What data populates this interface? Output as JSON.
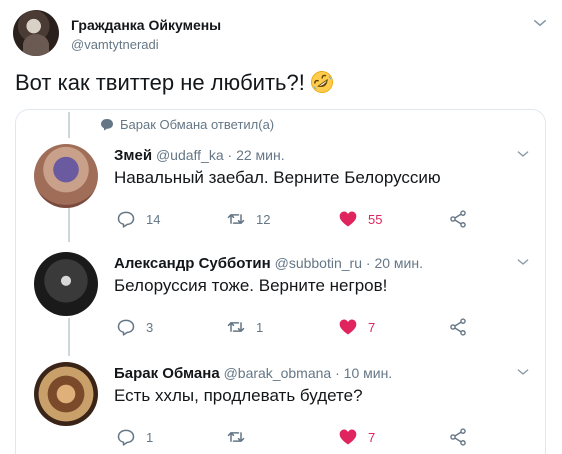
{
  "outer_tweet": {
    "author_name": "Гражданка Ойкумены",
    "author_handle": "@vamtytneradi",
    "text": "Вот как твиттер не любить?!",
    "emoji": "rolling-on-floor-laughing-icon"
  },
  "quoted": {
    "reply_context": "Барак Обмана ответил(а)",
    "tweets": [
      {
        "name": "Змей",
        "handle": "@udaff_ka",
        "time": "22 мин.",
        "text": "Навальный заебал. Верните Белоруссию",
        "replies": "14",
        "retweets": "12",
        "likes": "55"
      },
      {
        "name": "Александр Субботин",
        "handle": "@subbotin_ru",
        "time": "20 мин.",
        "text": "Белоруссия тоже. Верните негров!",
        "replies": "3",
        "retweets": "1",
        "likes": "7"
      },
      {
        "name": "Барак Обмана",
        "handle": "@barak_obmana",
        "time": "10 мин.",
        "text": "Есть ххлы, продлевать будете?",
        "replies": "1",
        "retweets": "",
        "likes": "7"
      }
    ],
    "separator": "·"
  },
  "colors": {
    "text": "#14171a",
    "muted": "#657786",
    "like": "#e0245e",
    "border": "#e1e8ed",
    "thread_line": "#ccd6dd"
  }
}
